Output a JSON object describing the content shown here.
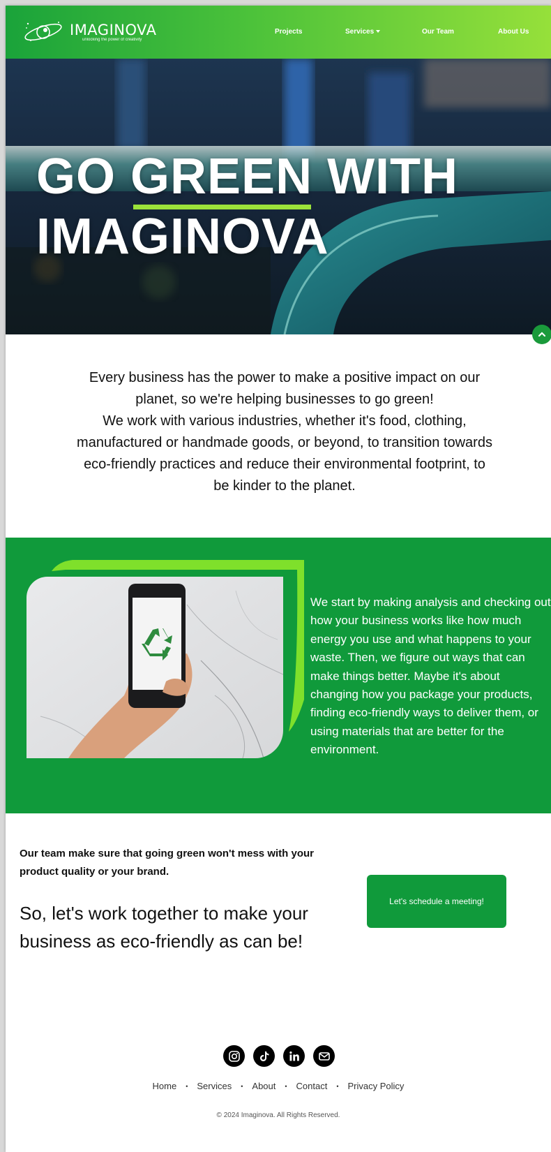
{
  "header": {
    "logo": {
      "name": "IMAGINOVA",
      "tagline": "unlocking the power of creativity"
    },
    "nav": [
      {
        "label": "Projects"
      },
      {
        "label": "Services"
      },
      {
        "label": "Our Team"
      },
      {
        "label": "About Us"
      }
    ]
  },
  "hero": {
    "title_line1_a": "GO ",
    "title_line1_b": "GREEN",
    "title_line1_c": " WITH",
    "title_line2": "IMAGINOVA"
  },
  "intro": {
    "p1": "Every business has the power to make a positive impact on our planet, so we're helping businesses to go green!",
    "p2": "We work with various industries, whether it's food, clothing, manufactured or handmade goods, or beyond, to transition towards eco-friendly practices and reduce their environmental footprint, to be kinder to the planet."
  },
  "process": {
    "text": "We start by making analysis and checking out how your business works like how much energy you use and what happens to your waste. Then, we figure out ways that can make things better. Maybe it's about changing how you package your products, finding eco-friendly ways to deliver them, or using materials that are better for the environment."
  },
  "cta": {
    "small": "Our team make sure that going green won't mess with your product quality or your brand.",
    "big": "So, let's work together to make your business as eco-friendly as can be!",
    "button": "Let's schedule a meeting!"
  },
  "footer": {
    "socials": [
      "instagram-icon",
      "tiktok-icon",
      "linkedin-icon",
      "email-icon"
    ],
    "links": [
      "Home",
      "Services",
      "About",
      "Contact",
      "Privacy Policy"
    ],
    "copyright": "© 2024 Imaginova. All Rights Reserved."
  },
  "colors": {
    "brand_green": "#109a3b",
    "accent_lime": "#9be23a",
    "header_start": "#1aa33a",
    "header_end": "#96e03a"
  }
}
